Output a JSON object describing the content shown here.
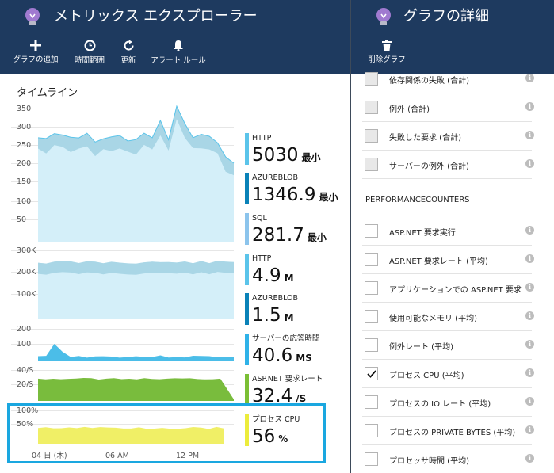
{
  "left_blade": {
    "title": "メトリックス エクスプローラー",
    "toolbar": [
      {
        "label": "グラフの追加",
        "icon": "plus-icon"
      },
      {
        "label": "時間範囲",
        "icon": "clock-icon"
      },
      {
        "label": "更新",
        "icon": "refresh-icon"
      },
      {
        "label": "アラート ルール",
        "icon": "bell-icon"
      }
    ],
    "timeline_title": "タイムライン",
    "charts": [
      {
        "yticks": [
          "350",
          "300",
          "250",
          "200",
          "150",
          "100",
          "50"
        ],
        "metrics": [
          {
            "label": "HTTP",
            "value": "5030",
            "suffix": "最小",
            "color": "#5bc4ea"
          },
          {
            "label": "AZUREBLOB",
            "value": "1346.9",
            "suffix": "最小",
            "color": "#0a82b8"
          },
          {
            "label": "SQL",
            "value": "281.7",
            "suffix": "最小",
            "color": "#8cc4ec"
          }
        ]
      },
      {
        "yticks": [
          "300K",
          "200K",
          "100K"
        ],
        "metrics": [
          {
            "label": "HTTP",
            "value": "4.9",
            "suffix": "M",
            "color": "#5bc4ea"
          },
          {
            "label": "AZUREBLOB",
            "value": "1.5",
            "suffix": "M",
            "color": "#0a82b8"
          }
        ]
      },
      {
        "yticks": [
          "200",
          "100"
        ],
        "metrics": [
          {
            "label": "サーバーの応答時間",
            "value": "40.6",
            "suffix": "MS",
            "color": "#2fb2e8"
          }
        ]
      },
      {
        "yticks": [
          "40/S",
          "20/S"
        ],
        "metrics": [
          {
            "label": "ASP.NET 要求レート",
            "value": "32.4",
            "suffix": "/S",
            "color": "#7bbf35"
          }
        ]
      },
      {
        "yticks": [
          "100%",
          "50%"
        ],
        "metrics": [
          {
            "label": "プロセス CPU",
            "value": "56",
            "suffix": "%",
            "color": "#ecec3c"
          }
        ]
      }
    ],
    "x_axis_labels": [
      "04 日 (木)",
      "06 AM",
      "12 PM"
    ]
  },
  "right_blade": {
    "title": "グラフの詳細",
    "toolbar": [
      {
        "label": "削除グラフ",
        "icon": "trash-icon"
      }
    ],
    "top_rows": [
      {
        "label": "依存関係の失敗 (合計)",
        "checked": false
      },
      {
        "label": "例外 (合計)",
        "checked": false
      },
      {
        "label": "失敗した要求 (合計)",
        "checked": false
      },
      {
        "label": "サーバーの例外 (合計)",
        "checked": false
      }
    ],
    "section_header": "PERFORMANCECOUNTERS",
    "perf_rows": [
      {
        "label": "ASP.NET 要求実行",
        "checked": false
      },
      {
        "label": "ASP.NET 要求レート (平均)",
        "checked": false
      },
      {
        "label": "アプリケーションでの ASP.NET 要求",
        "checked": false
      },
      {
        "label": "使用可能なメモリ (平均)",
        "checked": false
      },
      {
        "label": "例外レート (平均)",
        "checked": false
      },
      {
        "label": "プロセス CPU (平均)",
        "checked": true
      },
      {
        "label": "プロセスの IO レート (平均)",
        "checked": false
      },
      {
        "label": "プロセスの PRIVATE BYTES (平均)",
        "checked": false
      },
      {
        "label": "プロセッサ時間 (平均)",
        "checked": false
      }
    ]
  }
}
